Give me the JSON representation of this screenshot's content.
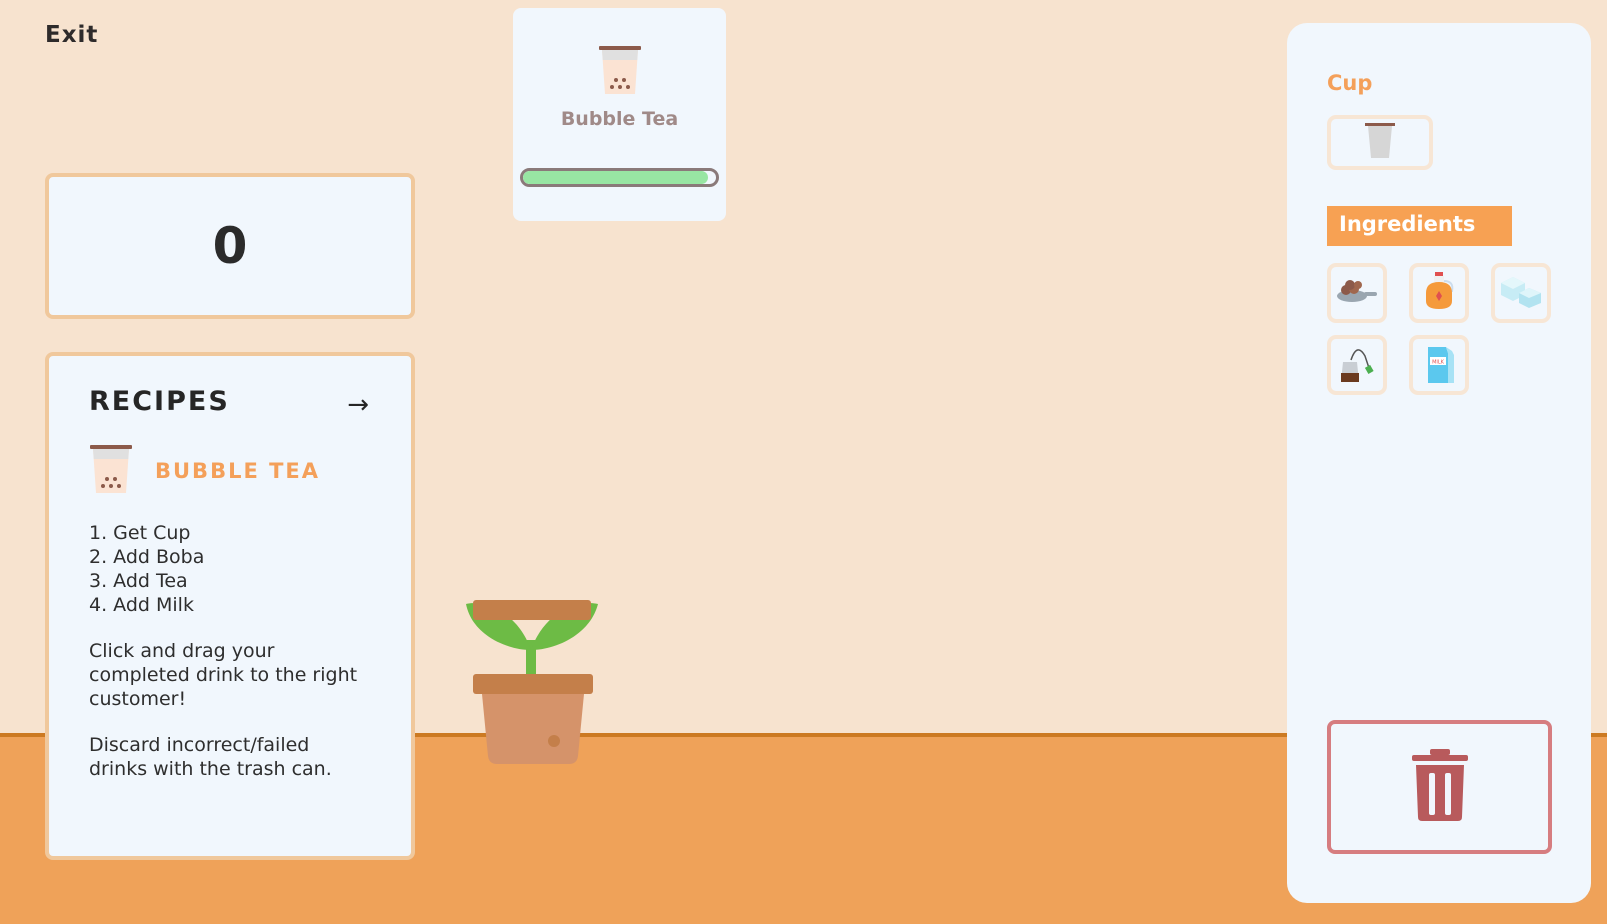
{
  "header": {
    "exit_label": "Exit"
  },
  "score": {
    "value": "0"
  },
  "recipes": {
    "title": "RECIPES",
    "next_icon": "arrow-right-icon",
    "current": {
      "name": "BUBBLE TEA",
      "icon": "bubble-tea-icon",
      "steps": [
        "1. Get Cup",
        "2. Add Boba",
        "3. Add Tea",
        "4. Add Milk"
      ]
    },
    "instructions": [
      "Click and drag your completed drink to the right customer!",
      "Discard incorrect/failed drinks with the trash can."
    ]
  },
  "order": {
    "drink_name": "Bubble Tea",
    "icon": "bubble-tea-icon",
    "timer_progress": 0.96,
    "timer_color": "#98e6a3"
  },
  "sidebar": {
    "cup_title": "Cup",
    "cup_icon": "empty-cup-icon",
    "ingredients_title": "Ingredients",
    "ingredients": [
      {
        "icon": "boba-pan-icon"
      },
      {
        "icon": "syrup-bottle-icon"
      },
      {
        "icon": "ice-cubes-icon"
      },
      {
        "icon": "tea-bag-icon"
      },
      {
        "icon": "milk-carton-icon"
      }
    ],
    "trash_icon": "trash-can-icon"
  },
  "colors": {
    "wall": "#f7e3cf",
    "floor": "#efa259",
    "accent": "#f4a05a",
    "panel": "#f1f7fd",
    "trash": "#b85a5c"
  }
}
